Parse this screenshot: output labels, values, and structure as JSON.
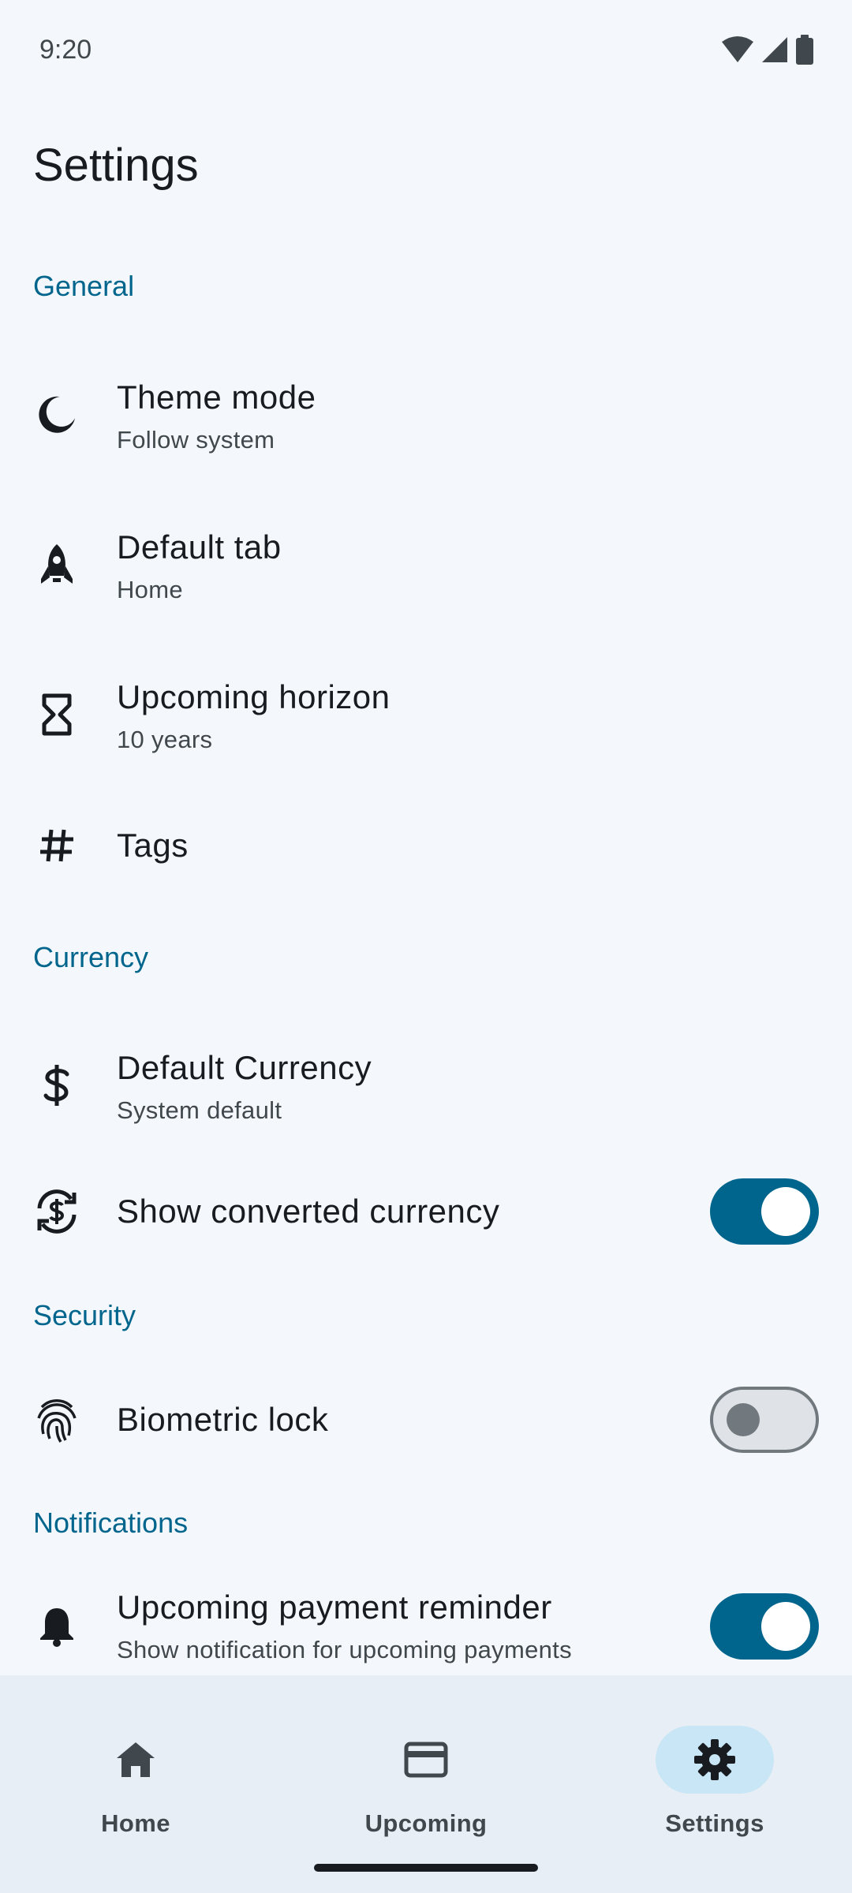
{
  "status_bar": {
    "time": "9:20",
    "icons": [
      "wifi-icon",
      "cellular-signal-icon",
      "battery-icon"
    ]
  },
  "page": {
    "title": "Settings"
  },
  "sections": {
    "general": "General",
    "currency": "Currency",
    "security": "Security",
    "notifications": "Notifications"
  },
  "rows": {
    "theme_mode": {
      "title": "Theme mode",
      "subtitle": "Follow system",
      "icon": "moon-icon"
    },
    "default_tab": {
      "title": "Default tab",
      "subtitle": "Home",
      "icon": "rocket-icon"
    },
    "upcoming_horizon": {
      "title": "Upcoming horizon",
      "subtitle": "10 years",
      "icon": "hourglass-icon"
    },
    "tags": {
      "title": "Tags",
      "icon": "hash-icon"
    },
    "default_currency": {
      "title": "Default Currency",
      "subtitle": "System default",
      "icon": "dollar-icon"
    },
    "show_converted_currency": {
      "title": "Show converted currency",
      "icon": "currency-exchange-icon",
      "enabled": true
    },
    "biometric_lock": {
      "title": "Biometric lock",
      "icon": "fingerprint-icon",
      "enabled": false
    },
    "upcoming_payment_reminder": {
      "title": "Upcoming payment reminder",
      "subtitle": "Show notification for upcoming payments",
      "icon": "bell-icon",
      "enabled": true
    }
  },
  "bottom_nav": {
    "items": [
      {
        "label": "Home",
        "icon": "home-icon",
        "active": false
      },
      {
        "label": "Upcoming",
        "icon": "credit-card-icon",
        "active": false
      },
      {
        "label": "Settings",
        "icon": "gear-icon",
        "active": true
      }
    ]
  },
  "colors": {
    "background": "#f4f8fd",
    "accent": "#00658c",
    "nav_background": "#e8eef5",
    "nav_active_indicator": "#c8e6f5"
  }
}
